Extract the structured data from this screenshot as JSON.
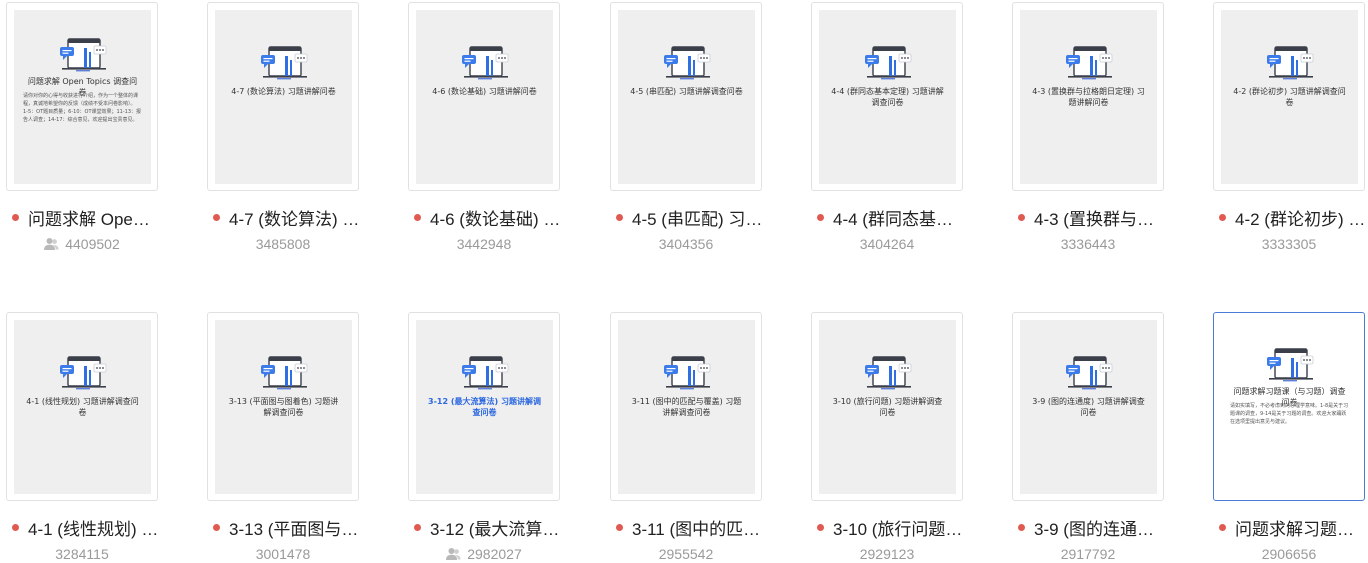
{
  "colors": {
    "status_dot": "#e05a52",
    "selected_border": "#4a7bd8",
    "highlight_title": "#2c68e0"
  },
  "icons": {
    "document": "survey-document-icon",
    "shared": "user-icon"
  },
  "cards": [
    {
      "name": "问题求解 Ope…",
      "id": "4409502",
      "shared": true,
      "thumb_title": "问题求解 Open Topics 调查问卷",
      "thumb_body": "请你对你的心得与收获进行介绍，作为一个整体的课程，真诚地希望你的反馈（成绩不受本问卷影响）。\n1-5：OT题目质量；6-10：OT课堂效果；11-13：报告人调查；14-17：综合意见，欢迎提出宝贵意见。"
    },
    {
      "name": "4-7 (数论算法) …",
      "id": "3485808",
      "shared": false,
      "thumb_title": "4-7 (数论算法) 习题讲解问卷",
      "thumb_body": ""
    },
    {
      "name": "4-6 (数论基础) …",
      "id": "3442948",
      "shared": false,
      "thumb_title": "4-6 (数论基础) 习题讲解问卷",
      "thumb_body": ""
    },
    {
      "name": "4-5 (串匹配) 习…",
      "id": "3404356",
      "shared": false,
      "thumb_title": "4-5 (串匹配) 习题讲解调查问卷",
      "thumb_body": ""
    },
    {
      "name": "4-4 (群同态基…",
      "id": "3404264",
      "shared": false,
      "thumb_title": "4-4 (群同态基本定理) 习题讲解调查问卷",
      "thumb_body": ""
    },
    {
      "name": "4-3 (置换群与…",
      "id": "3336443",
      "shared": false,
      "thumb_title": "4-3 (置换群与拉格朗日定理) 习题讲解问卷",
      "thumb_body": ""
    },
    {
      "name": "4-2 (群论初步) …",
      "id": "3333305",
      "shared": false,
      "thumb_title": "4-2 (群论初步) 习题讲解调查问卷",
      "thumb_body": ""
    },
    {
      "name": "4-1 (线性规划) …",
      "id": "3284115",
      "shared": false,
      "thumb_title": "4-1 (线性规划) 习题讲解调查问卷",
      "thumb_body": ""
    },
    {
      "name": "3-13 (平面图与…",
      "id": "3001478",
      "shared": false,
      "thumb_title": "3-13 (平面图与图着色) 习题讲解调查问卷",
      "thumb_body": ""
    },
    {
      "name": "3-12 (最大流算…",
      "id": "2982027",
      "shared": true,
      "thumb_title": "3-12 (最大流算法) 习题讲解调查问卷",
      "thumb_body": "",
      "title_highlight": true
    },
    {
      "name": "3-11 (图中的匹…",
      "id": "2955542",
      "shared": false,
      "thumb_title": "3-11 (图中的匹配与覆盖) 习题讲解调查问卷",
      "thumb_body": ""
    },
    {
      "name": "3-10 (旅行问题…",
      "id": "2929123",
      "shared": false,
      "thumb_title": "3-10 (旅行问题) 习题讲解调查问卷",
      "thumb_body": ""
    },
    {
      "name": "3-9 (图的连通…",
      "id": "2917792",
      "shared": false,
      "thumb_title": "3-9 (图的连通度) 习题讲解调查问卷",
      "thumb_body": ""
    },
    {
      "name": "问题求解习题…",
      "id": "2906656",
      "shared": false,
      "selected": true,
      "thumb_title": "问题求解习题课（与习题）调查问卷",
      "thumb_body": "请如实填写，不必考虑到的心理学意味。1-8是关于习题课的调查，9-14是关于习题的调查。欢迎大家踊跃在选项里提出意见与建议。"
    }
  ]
}
